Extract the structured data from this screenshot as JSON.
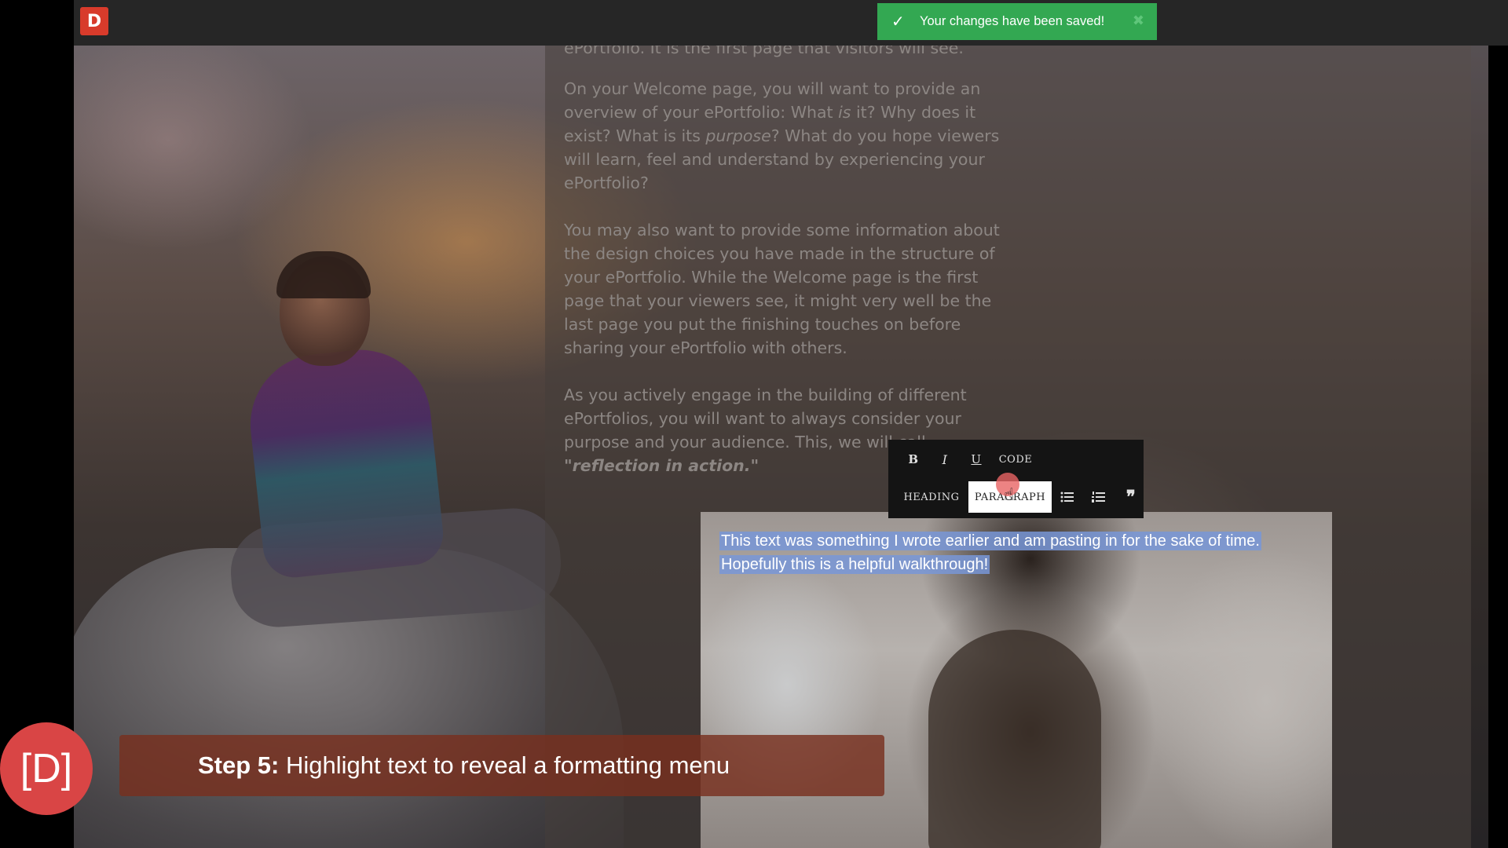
{
  "app": {
    "logo_letter": "D"
  },
  "toast": {
    "message": "Your changes have been saved!",
    "icon": "check-icon",
    "close_icon": "close-icon",
    "color": "#33a852"
  },
  "content": {
    "cut_line": "ePortfolio. It is the first page that visitors will see.",
    "paragraphs": [
      "On your Welcome page, you will want to provide an overview of your ePortfolio: What is it? Why does it exist?  What is its purpose? What do you hope viewers will learn, feel and understand by experiencing your ePortfolio?",
      "You may also want to provide some information about the design choices you have made in the structure of your ePortfolio. While the Welcome page is the first page that your viewers see, it might very well be the last page you put the finishing touches on before sharing your ePortfolio with others.",
      "As you actively engage in the building of different ePortfolios, you will want to always consider your purpose and your audience. This, we will call \"reflection in action.\""
    ],
    "selected_text": [
      "This text was something I wrote earlier and am pasting in for the sake of time.",
      "Hopefully this is a helpful walkthrough!"
    ]
  },
  "toolbar": {
    "bold": "B",
    "italic": "I",
    "underline": "U",
    "code": "CODE",
    "heading": "HEADING",
    "paragraph": "PARAGRAPH",
    "bullet_list_icon": "bullet-list-icon",
    "numbered_list_icon": "numbered-list-icon",
    "quote_icon": "quote-icon"
  },
  "caption": {
    "step": "Step 5:",
    "text": " Highlight text to reveal a formatting menu"
  },
  "badge": {
    "text": "[D]",
    "color": "#d94545"
  }
}
